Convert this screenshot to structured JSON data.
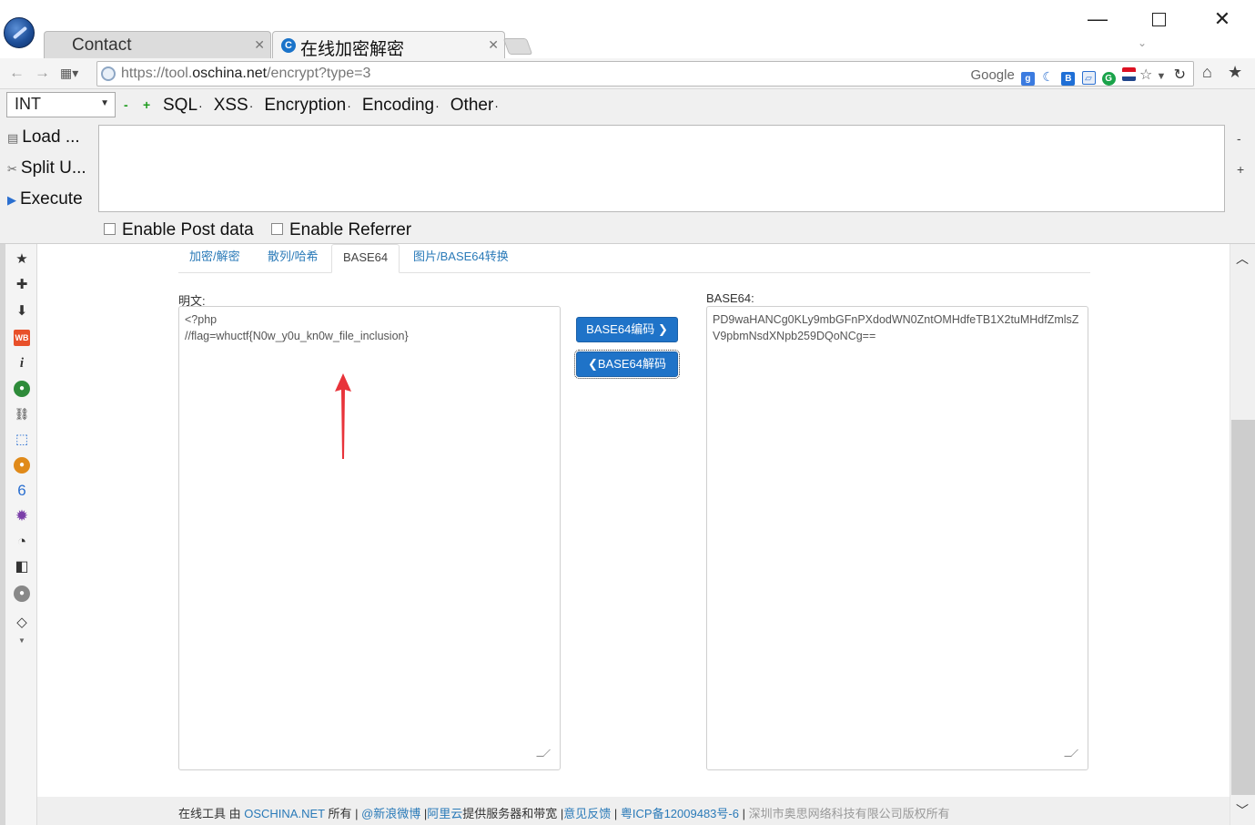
{
  "tabs": [
    {
      "label": "Contact"
    },
    {
      "label": "在线加密解密"
    }
  ],
  "nav": {
    "url_scheme": "https://tool.",
    "url_host": "oschina.net",
    "url_path": "/encrypt?type=3",
    "search_engine": "Google"
  },
  "hackbar": {
    "select_value": "INT",
    "minus": "-",
    "plus": "+",
    "menus": [
      "SQL",
      "XSS",
      "Encryption",
      "Encoding",
      "Other"
    ],
    "load_label": "Load ...",
    "split_label": "Split U...",
    "execute_label": "Execute",
    "side_minus": "-",
    "side_plus": "+",
    "post_label": "Enable Post data",
    "referrer_label": "Enable Referrer"
  },
  "page": {
    "tabs": [
      "加密/解密",
      "散列/哈希",
      "BASE64",
      "图片/BASE64转换"
    ],
    "plain_label": "明文:",
    "b64_label": "BASE64:",
    "plain_lines": [
      "<?php",
      "",
      "//flag=whuctf{N0w_y0u_kn0w_file_inclusion}"
    ],
    "b64_text": "PD9waHANCg0KLy9mbGFnPXdodWN0ZntOMHdfeTB1X2tuMHdfZmlsZV9pbmNsdXNpb259DQoNCg==",
    "encode_button": "BASE64编码",
    "decode_button": "BASE64解码"
  },
  "footer": {
    "t1": "在线工具 由 ",
    "l1": "OSCHINA.NET",
    "t2": " 所有 | ",
    "l2": "@新浪微博",
    "t3": " |",
    "l3": "阿里云",
    "t4": "提供服务器和带宽 |",
    "l4": "意见反馈",
    "t5": " | ",
    "l5": "粤ICP备12009483号-6",
    "t6": " | ",
    "t7": "深圳市奥思网络科技有限公司版权所有"
  },
  "colors": {
    "accent": "#1f73c8",
    "link": "#2a7ab8",
    "annotation_arrow": "#e8333a"
  }
}
